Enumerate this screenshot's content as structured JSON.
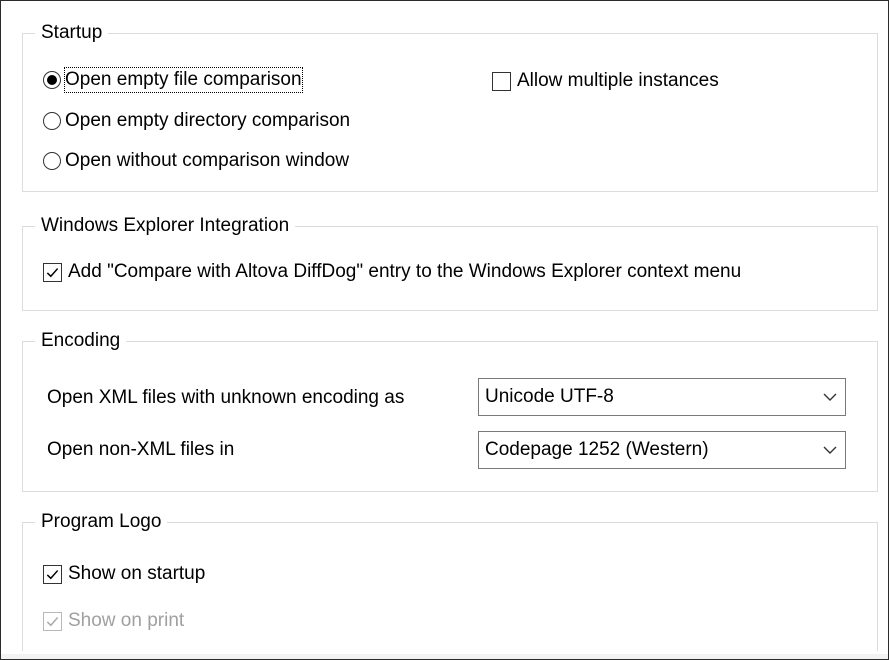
{
  "startup": {
    "title": "Startup",
    "options": [
      {
        "label": "Open empty file comparison",
        "selected": true
      },
      {
        "label": "Open empty directory comparison",
        "selected": false
      },
      {
        "label": "Open without comparison window",
        "selected": false
      }
    ],
    "allow_multiple": {
      "label": "Allow multiple instances",
      "checked": false
    }
  },
  "explorer": {
    "title": "Windows Explorer Integration",
    "add_entry": {
      "label": "Add \"Compare with Altova DiffDog\" entry to the Windows Explorer context menu",
      "checked": true
    }
  },
  "encoding": {
    "title": "Encoding",
    "xml_label": "Open XML files with unknown encoding as",
    "xml_value": "Unicode UTF-8",
    "nonxml_label": "Open non-XML files in",
    "nonxml_value": "Codepage 1252 (Western)"
  },
  "logo": {
    "title": "Program Logo",
    "show_startup": {
      "label": "Show on startup",
      "checked": true
    },
    "show_print": {
      "label": "Show on print",
      "checked": true,
      "disabled": true
    }
  },
  "icons": {
    "radio": "radio-button",
    "check": "checkmark-icon",
    "dropdown": "chevron-down-icon"
  }
}
